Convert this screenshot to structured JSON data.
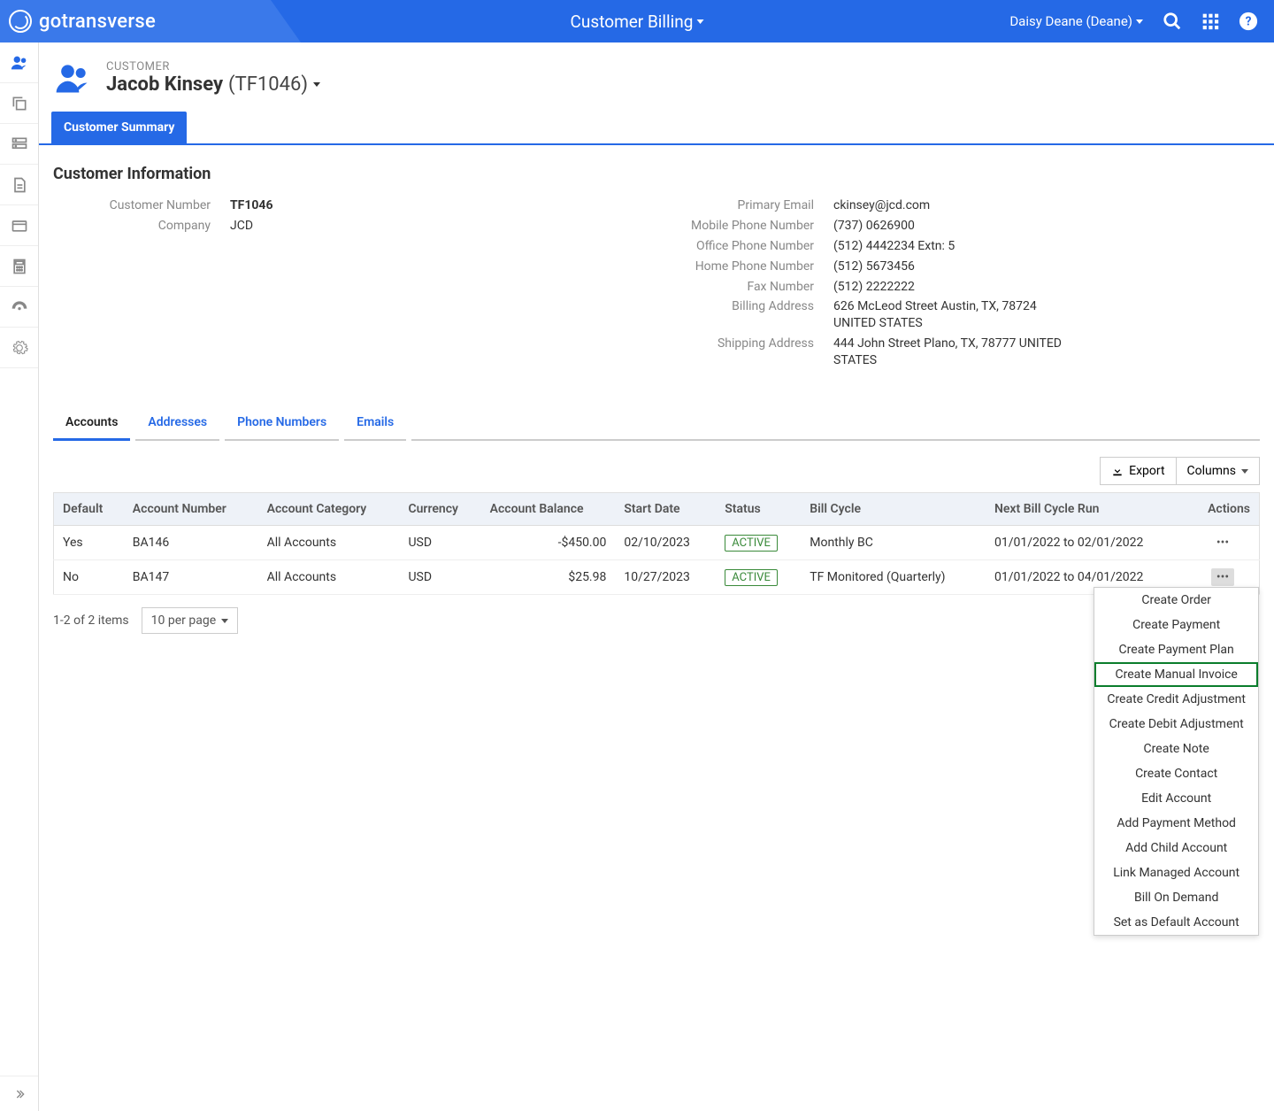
{
  "topbar": {
    "brand": "gotransverse",
    "app_title": "Customer Billing",
    "user_display": "Daisy Deane (Deane)"
  },
  "page": {
    "eyebrow": "CUSTOMER",
    "customer_name": "Jacob Kinsey",
    "customer_code": "(TF1046)",
    "primary_tab": "Customer Summary"
  },
  "customer_info": {
    "heading": "Customer Information",
    "left": [
      {
        "label": "Customer Number",
        "value": "TF1046",
        "strong": true
      },
      {
        "label": "Company",
        "value": "JCD"
      }
    ],
    "right": [
      {
        "label": "Primary Email",
        "value": "ckinsey@jcd.com"
      },
      {
        "label": "Mobile Phone Number",
        "value": "(737) 0626900"
      },
      {
        "label": "Office Phone Number",
        "value": "(512) 4442234 Extn: 5"
      },
      {
        "label": "Home Phone Number",
        "value": "(512) 5673456"
      },
      {
        "label": "Fax Number",
        "value": "(512) 2222222"
      },
      {
        "label": "Billing Address",
        "value": "626 McLeod Street Austin, TX, 78724 UNITED STATES"
      },
      {
        "label": "Shipping Address",
        "value": "444 John Street Plano, TX, 78777 UNITED STATES"
      }
    ]
  },
  "subtabs": [
    "Accounts",
    "Addresses",
    "Phone Numbers",
    "Emails"
  ],
  "subtab_active": 0,
  "toolbar": {
    "export": "Export",
    "columns": "Columns"
  },
  "table": {
    "headers": [
      "Default",
      "Account Number",
      "Account Category",
      "Currency",
      "Account Balance",
      "Start Date",
      "Status",
      "Bill Cycle",
      "Next Bill Cycle Run",
      "Actions"
    ],
    "rows": [
      {
        "default": "Yes",
        "acct": "BA146",
        "cat": "All Accounts",
        "curr": "USD",
        "bal": "-$450.00",
        "start": "02/10/2023",
        "status": "ACTIVE",
        "cycle": "Monthly BC",
        "next": "01/01/2022 to 02/01/2022",
        "menu_open": false
      },
      {
        "default": "No",
        "acct": "BA147",
        "cat": "All Accounts",
        "curr": "USD",
        "bal": "$25.98",
        "start": "10/27/2023",
        "status": "ACTIVE",
        "cycle": "TF Monitored (Quarterly)",
        "next": "01/01/2022 to 04/01/2022",
        "menu_open": true
      }
    ]
  },
  "actions_menu": {
    "highlight_index": 3,
    "items": [
      "Create Order",
      "Create Payment",
      "Create Payment Plan",
      "Create Manual Invoice",
      "Create Credit Adjustment",
      "Create Debit Adjustment",
      "Create Note",
      "Create Contact",
      "Edit Account",
      "Add Payment Method",
      "Add Child Account",
      "Link Managed Account",
      "Bill On Demand",
      "Set as Default Account"
    ]
  },
  "pager": {
    "summary": "1-2 of 2 items",
    "per_page": "10 per page"
  }
}
